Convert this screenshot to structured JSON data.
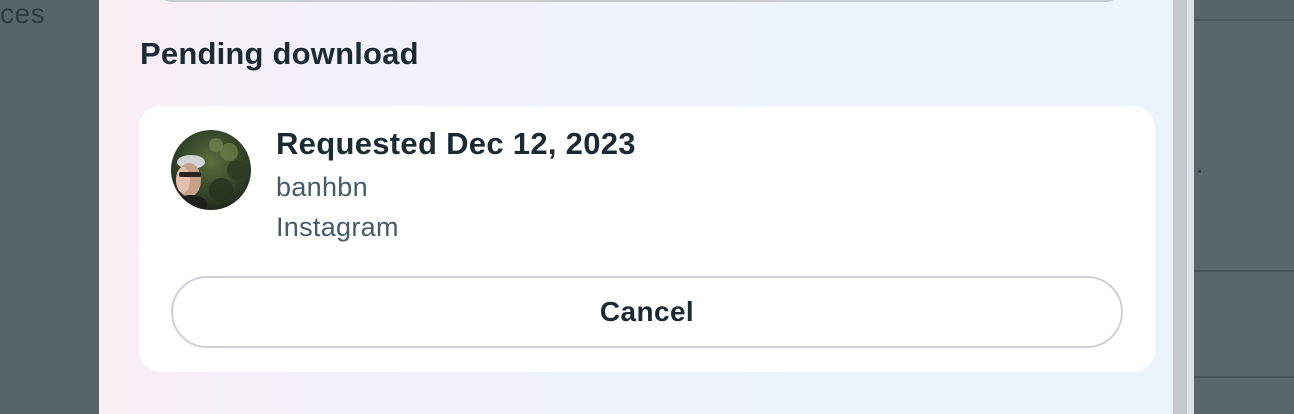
{
  "background": {
    "left_text": "ces"
  },
  "section": {
    "title": "Pending download"
  },
  "request": {
    "title": "Requested Dec 12, 2023",
    "username": "banhbn",
    "app": "Instagram",
    "avatar_icon": "profile-photo"
  },
  "actions": {
    "cancel_label": "Cancel"
  },
  "colors": {
    "text_primary": "#1c2b33",
    "text_secondary": "#465a69",
    "card_bg": "#ffffff",
    "backdrop": "#57646c"
  }
}
